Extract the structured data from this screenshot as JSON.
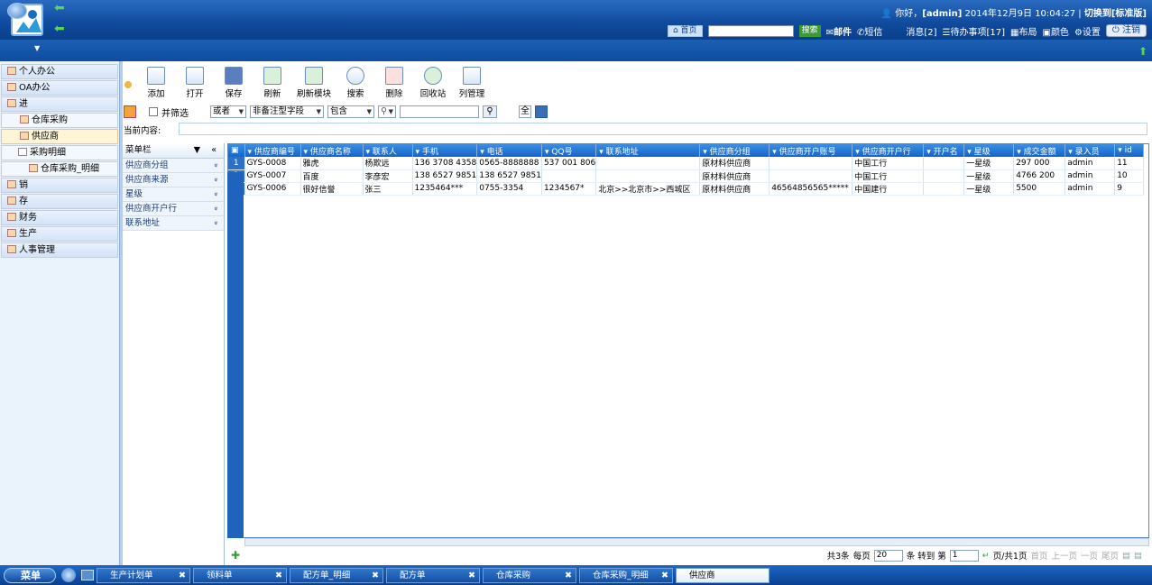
{
  "header": {
    "greeting_prefix": "你好，",
    "user": "[admin]",
    "datetime": "2014年12月9日 10:04:27",
    "switch_link": "切换到[标准版]",
    "home": "首页",
    "search_btn": "搜索",
    "mail": "邮件",
    "sms": "短信",
    "messages": "消息[2]",
    "todo": "待办事项[17]",
    "layout": "布局",
    "color": "颜色",
    "settings": "设置",
    "logout": "注销"
  },
  "sidebar": {
    "items": [
      {
        "label": "个人办公",
        "level": 0
      },
      {
        "label": "OA办公",
        "level": 0
      },
      {
        "label": "进",
        "level": 0
      },
      {
        "label": "仓库采购",
        "level": 1
      },
      {
        "label": "供应商",
        "level": 1,
        "active": true
      },
      {
        "label": "采购明细",
        "level": 1
      },
      {
        "label": "仓库采购_明细",
        "level": 2
      },
      {
        "label": "销",
        "level": 0
      },
      {
        "label": "存",
        "level": 0
      },
      {
        "label": "财务",
        "level": 0
      },
      {
        "label": "生产",
        "level": 0
      },
      {
        "label": "人事管理",
        "level": 0
      }
    ]
  },
  "toolbar": {
    "add": "添加",
    "open": "打开",
    "save": "保存",
    "refresh": "刷新",
    "refresh_module": "刷新模块",
    "search": "搜索",
    "delete": "删除",
    "recycle": "回收站",
    "columns": "列管理"
  },
  "filter": {
    "and_filter": "并筛选",
    "logic": "或者",
    "field": "非备注型字段",
    "op": "包含",
    "all_btn": "全",
    "current_label": "当前内容:"
  },
  "leftpanel": {
    "header": "菜单栏",
    "items": [
      "供应商分组",
      "供应商来源",
      "星级",
      "供应商开户行",
      "联系地址"
    ]
  },
  "grid": {
    "columns": [
      "供应商编号",
      "供应商名称",
      "联系人",
      "手机",
      "电话",
      "QQ号",
      "联系地址",
      "供应商分组",
      "供应商开户账号",
      "供应商开户行",
      "开户名",
      "星级",
      "成交金额",
      "录入员",
      "id"
    ],
    "rows": [
      [
        "1",
        "GYS-0008",
        "雅虎",
        "杨欺远",
        "136 3708 4358",
        "0565-8888888",
        "537 001 806",
        "",
        "原材料供应商",
        "",
        "中国工行",
        "",
        "一星级",
        "297 000",
        "admin",
        "11"
      ],
      [
        "2",
        "GYS-0007",
        "百度",
        "李彦宏",
        "138 6527 9851",
        "138 6527 9851",
        "",
        "",
        "原材料供应商",
        "",
        "中国工行",
        "",
        "一星级",
        "4766 200",
        "admin",
        "10"
      ],
      [
        "3",
        "GYS-0006",
        "很好信誉",
        "张三",
        "1235464***",
        "0755-3354",
        "1234567*",
        "北京>>北京市>>西城区",
        "原材料供应商",
        "46564856565*****",
        "中国建行",
        "",
        "一星级",
        "5500",
        "admin",
        "9"
      ]
    ]
  },
  "pager": {
    "total": "共3条",
    "per_page_label": "每页",
    "per_page": "20",
    "goto_label": "条 转到 第",
    "page": "1",
    "page_of": "页/共1页",
    "first": "首页",
    "prev": "上一页",
    "next": "一页",
    "last": "尾页"
  },
  "taskbar": {
    "menu": "菜单",
    "tabs": [
      "生产计划单",
      "领料单",
      "配方单_明细",
      "配方单",
      "仓库采购",
      "仓库采购_明细",
      "供应商"
    ]
  }
}
